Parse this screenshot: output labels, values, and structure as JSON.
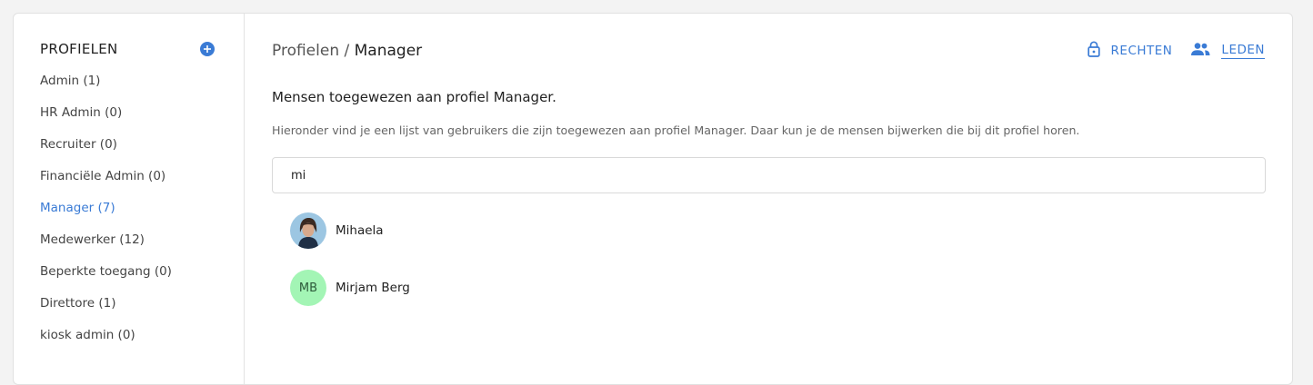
{
  "sidebar": {
    "title": "PROFIELEN",
    "items": [
      {
        "label": "Admin (1)",
        "active": false
      },
      {
        "label": "HR Admin (0)",
        "active": false
      },
      {
        "label": "Recruiter (0)",
        "active": false
      },
      {
        "label": "Financiële Admin (0)",
        "active": false
      },
      {
        "label": "Manager (7)",
        "active": true
      },
      {
        "label": "Medewerker (12)",
        "active": false
      },
      {
        "label": "Beperkte toegang (0)",
        "active": false
      },
      {
        "label": "Direttore (1)",
        "active": false
      },
      {
        "label": "kiosk admin (0)",
        "active": false
      }
    ]
  },
  "header": {
    "breadcrumb_parent": "Profielen",
    "breadcrumb_separator": " / ",
    "breadcrumb_current": "Manager",
    "tabs": [
      {
        "label": "RECHTEN",
        "icon": "lock-icon",
        "active": false
      },
      {
        "label": "LEDEN",
        "icon": "people-icon",
        "active": true
      }
    ]
  },
  "main": {
    "subtitle": "Mensen toegewezen aan profiel Manager.",
    "description": "Hieronder vind je een lijst van gebruikers die zijn toegewezen aan profiel Manager. Daar kun je de mensen bijwerken die bij dit profiel horen.",
    "search_value": "mi",
    "members": [
      {
        "name": "Mihaela",
        "initials": "",
        "avatar": "photo"
      },
      {
        "name": "Mirjam Berg",
        "initials": "MB",
        "avatar": "initials"
      }
    ]
  },
  "colors": {
    "accent": "#3a7bd5",
    "initials_avatar_bg": "#a3f5b5"
  }
}
